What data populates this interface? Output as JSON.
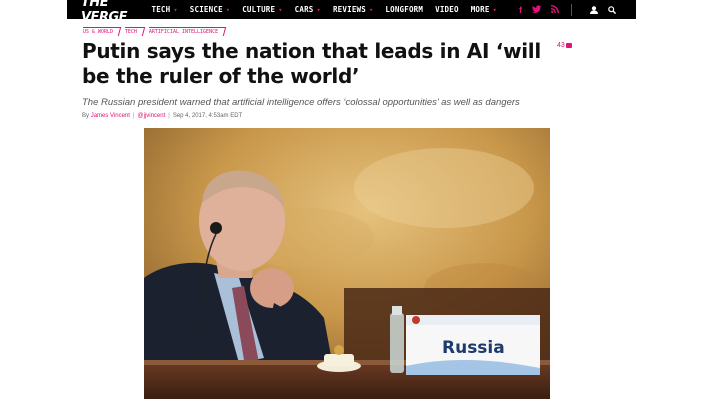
{
  "nav": {
    "logo": "THE VERGE",
    "items": [
      {
        "label": "TECH",
        "has_dropdown": true
      },
      {
        "label": "SCIENCE",
        "has_dropdown": true
      },
      {
        "label": "CULTURE",
        "has_dropdown": true
      },
      {
        "label": "CARS",
        "has_dropdown": true
      },
      {
        "label": "REVIEWS",
        "has_dropdown": true
      },
      {
        "label": "LONGFORM",
        "has_dropdown": false
      },
      {
        "label": "VIDEO",
        "has_dropdown": false
      },
      {
        "label": "MORE",
        "has_dropdown": true
      }
    ],
    "caret": "▾",
    "social": {
      "facebook": "f",
      "twitter": "t",
      "rss": "⌘"
    },
    "icons": [
      "user-icon",
      "search-icon"
    ]
  },
  "article": {
    "tags": [
      "US & World",
      "Tech",
      "Artificial Intelligence"
    ],
    "headline": "Putin says the nation that leads in AI ‘will be the ruler of the world’",
    "comment_count": "43",
    "dek": "The Russian president warned that artificial intelligence offers ‘colossal opportunities’ as well as dangers",
    "byline": {
      "prefix": "By",
      "author": "James Vincent",
      "divider": "|",
      "handle": "@jjvincent",
      "date": "Sep 4, 2017, 4:53am EDT"
    },
    "photo": {
      "placard_text": "Russia"
    }
  },
  "colors": {
    "accent": "#e2127a",
    "nav_bg": "#000000",
    "headline": "#111111"
  }
}
